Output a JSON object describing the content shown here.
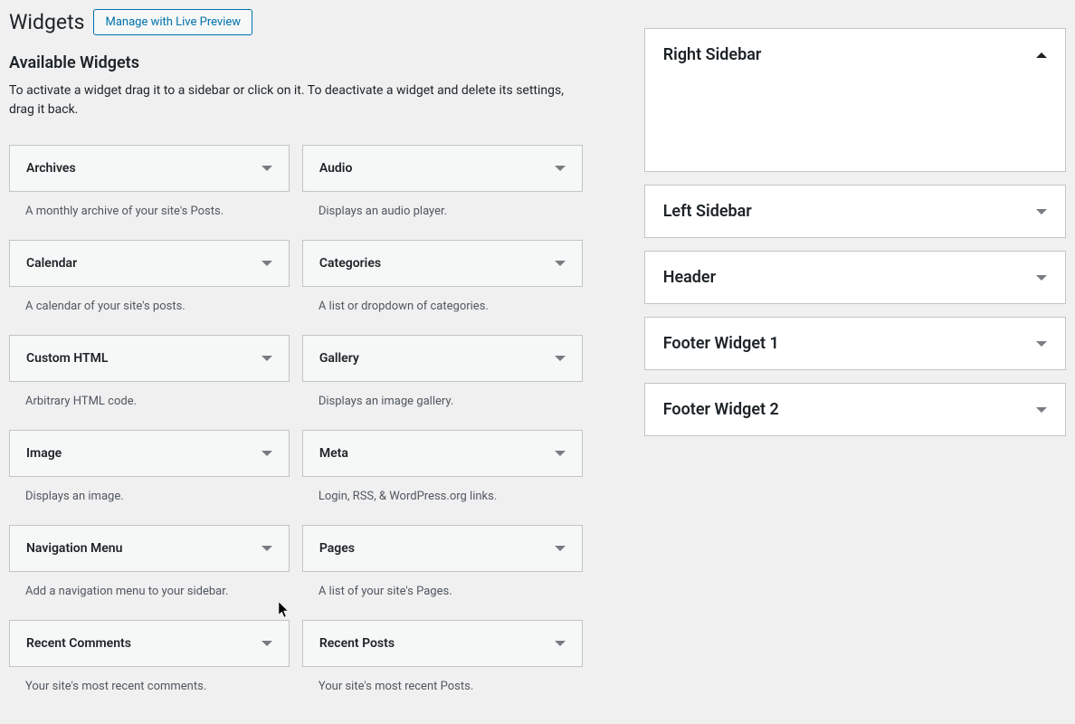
{
  "header": {
    "title": "Widgets",
    "manageButton": "Manage with Live Preview"
  },
  "availableWidgets": {
    "title": "Available Widgets",
    "description": "To activate a widget drag it to a sidebar or click on it. To deactivate a widget and delete its settings, drag it back.",
    "widgets": [
      {
        "name": "Archives",
        "description": "A monthly archive of your site's Posts."
      },
      {
        "name": "Audio",
        "description": "Displays an audio player."
      },
      {
        "name": "Calendar",
        "description": "A calendar of your site's posts."
      },
      {
        "name": "Categories",
        "description": "A list or dropdown of categories."
      },
      {
        "name": "Custom HTML",
        "description": "Arbitrary HTML code."
      },
      {
        "name": "Gallery",
        "description": "Displays an image gallery."
      },
      {
        "name": "Image",
        "description": "Displays an image."
      },
      {
        "name": "Meta",
        "description": "Login, RSS, & WordPress.org links."
      },
      {
        "name": "Navigation Menu",
        "description": "Add a navigation menu to your sidebar."
      },
      {
        "name": "Pages",
        "description": "A list of your site's Pages."
      },
      {
        "name": "Recent Comments",
        "description": "Your site's most recent comments."
      },
      {
        "name": "Recent Posts",
        "description": "Your site's most recent Posts."
      }
    ]
  },
  "sidebarAreas": [
    {
      "name": "Right Sidebar",
      "expanded": true
    },
    {
      "name": "Left Sidebar",
      "expanded": false
    },
    {
      "name": "Header",
      "expanded": false
    },
    {
      "name": "Footer Widget 1",
      "expanded": false
    },
    {
      "name": "Footer Widget 2",
      "expanded": false
    }
  ]
}
